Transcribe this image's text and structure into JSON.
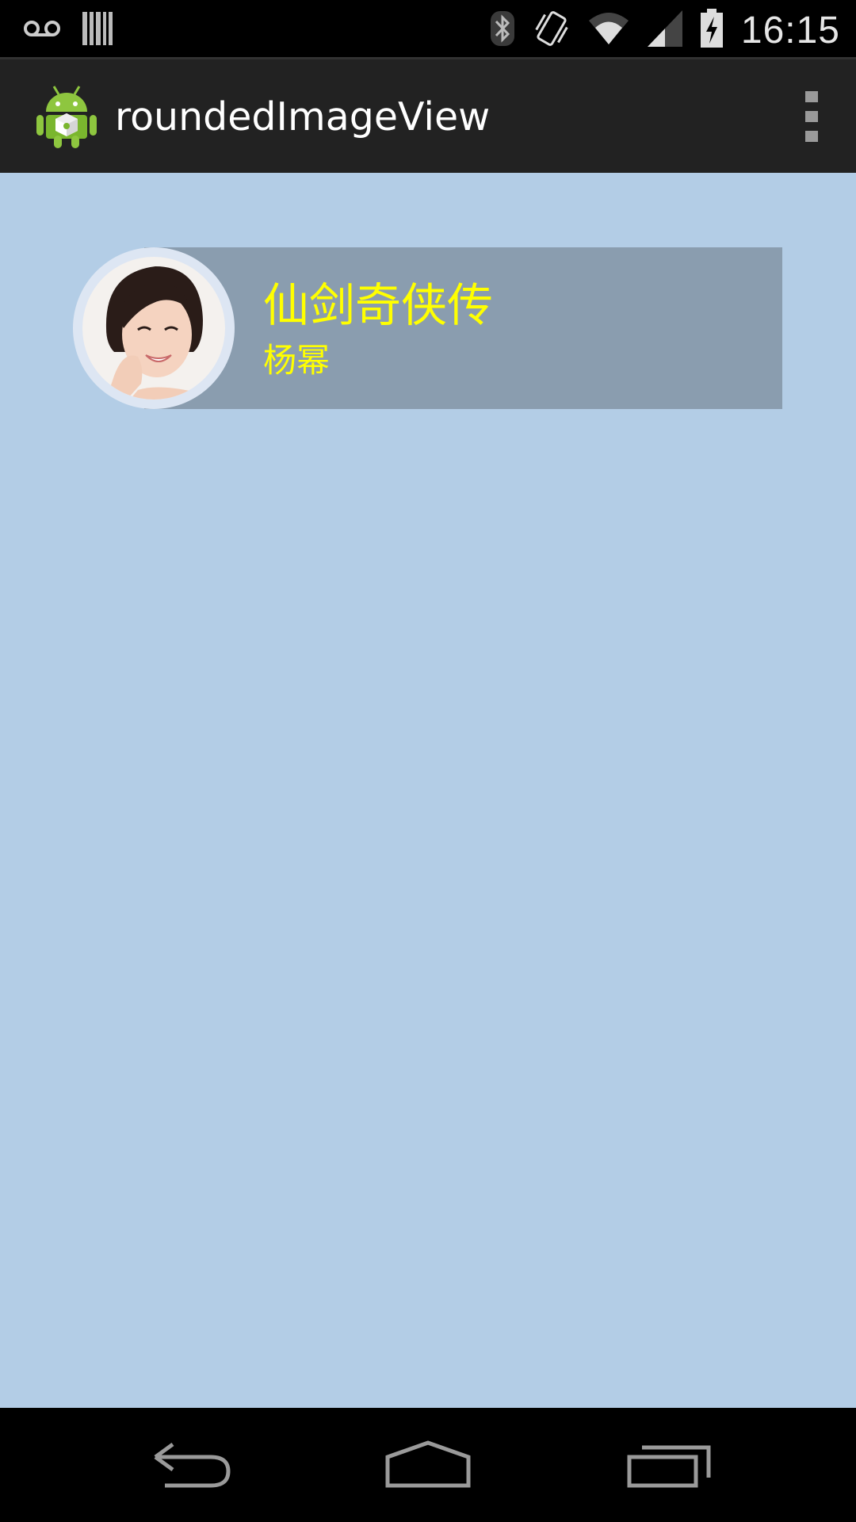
{
  "status_bar": {
    "time": "16:15",
    "icons": [
      "voicemail-icon",
      "barcode-icon",
      "bluetooth-icon",
      "vibrate-icon",
      "wifi-icon",
      "signal-icon",
      "battery-charging-icon"
    ]
  },
  "action_bar": {
    "title": "roundedImageView",
    "app_icon": "android-robot-icon",
    "overflow_icon": "overflow-menu-icon"
  },
  "card": {
    "title": "仙剑奇侠传",
    "subtitle": "杨幂",
    "avatar": "portrait-photo"
  },
  "nav_bar": {
    "buttons": [
      "back-icon",
      "home-icon",
      "recents-icon"
    ]
  },
  "colors": {
    "background": "#b3cde6",
    "action_bar": "#222222",
    "card_panel": "#8a9daf",
    "card_text": "#ffff00",
    "avatar_border": "#dde6f3"
  }
}
